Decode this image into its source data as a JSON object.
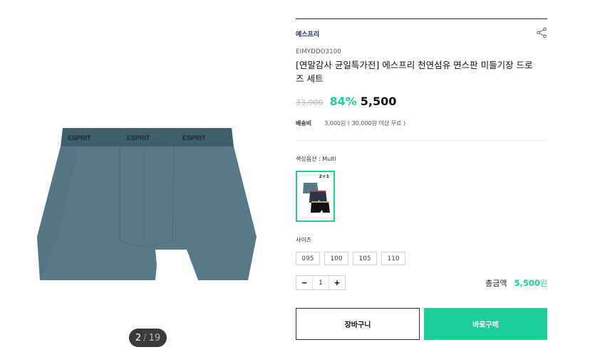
{
  "gallery": {
    "current": "2",
    "separator": "/",
    "total": "19",
    "waistband_text": "ESPRIT"
  },
  "product": {
    "brand": "에스프리",
    "sku": "EIMYDDO3100",
    "title": "[연말감사 균일특가전] 에스프리 천연섬유 면스판 미들기장 드로즈 세트",
    "original_price": "33,900",
    "discount": "84%",
    "price": "5,500"
  },
  "shipping": {
    "label": "배송비",
    "value": "3,000원 ( 30,000원 이상 무료 )"
  },
  "color_option": {
    "label": "색상옵션 : Multi",
    "badge": "2+1"
  },
  "size_option": {
    "label": "사이즈",
    "sizes": [
      "095",
      "100",
      "105",
      "110"
    ]
  },
  "quantity": {
    "minus": "−",
    "value": "1",
    "plus": "+"
  },
  "total": {
    "label": "총금액",
    "value": "5,500",
    "unit": "원"
  },
  "actions": {
    "cart": "장바구니",
    "buy": "바로구매"
  },
  "colors": {
    "accent": "#1ccf9a",
    "product_body": "#587a86",
    "waistband": "#3f5f6a"
  },
  "icons": {
    "share": "share-icon"
  }
}
